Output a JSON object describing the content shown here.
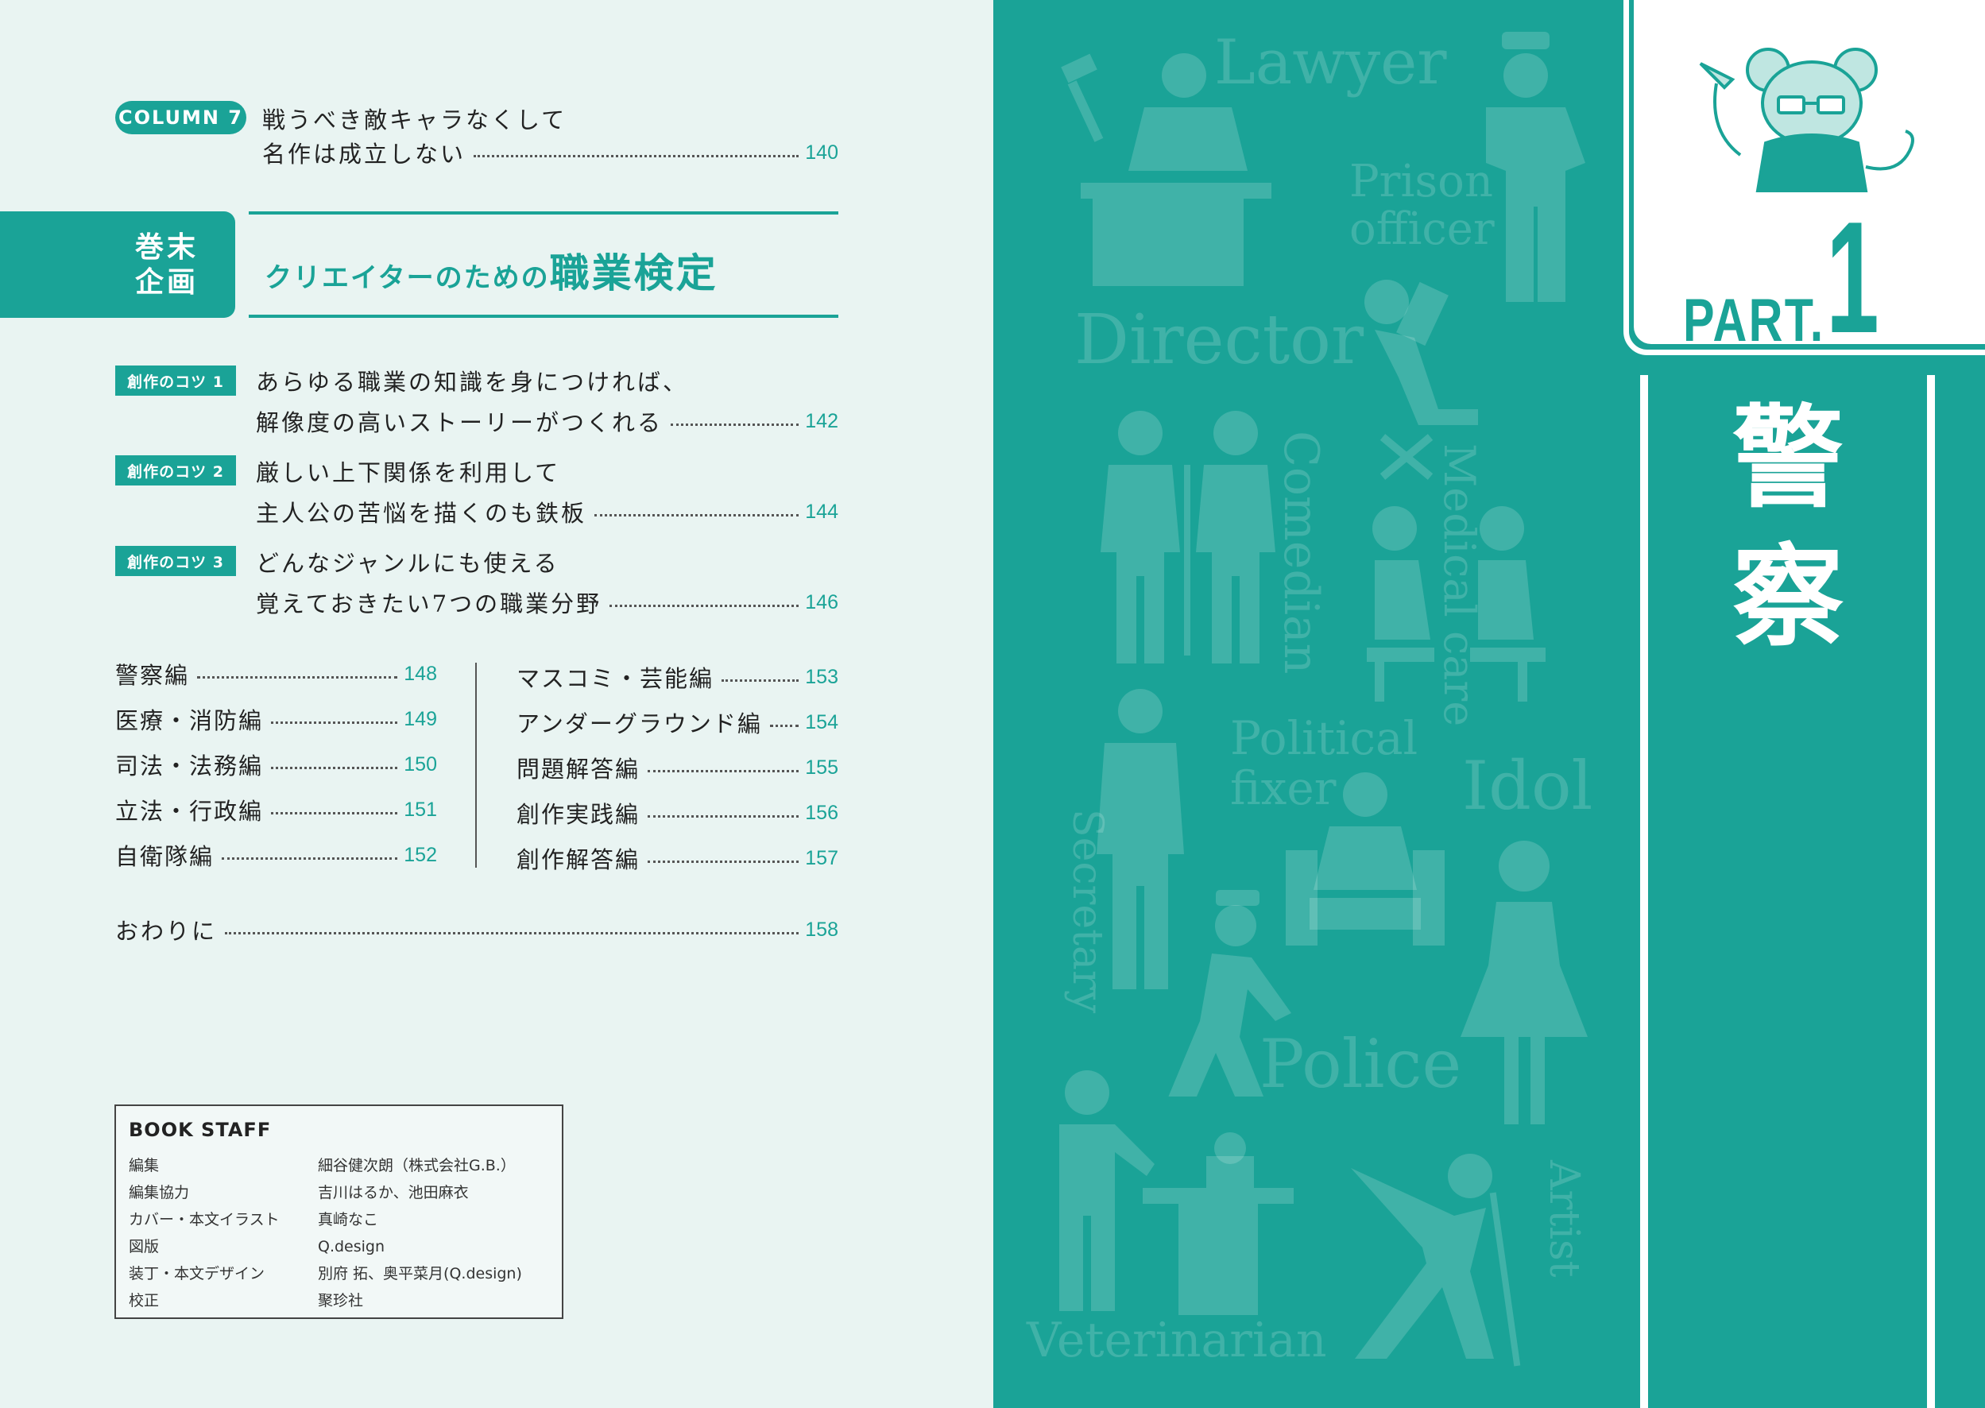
{
  "column7": {
    "badge": "COLUMN 7",
    "line1": "戦うべき敵キャラなくして",
    "line2": "名作は成立しない",
    "page": "140"
  },
  "kanmatsu": {
    "label_line1": "巻末",
    "label_line2": "企画",
    "title_small": "クリエイターのための",
    "title_big": "職業検定"
  },
  "tips": [
    {
      "badge": "創作のコツ 1",
      "line1": "あらゆる職業の知識を身につければ、",
      "line2": "解像度の高いストーリーがつくれる",
      "page": "142"
    },
    {
      "badge": "創作のコツ 2",
      "line1": "厳しい上下関係を利用して",
      "line2": "主人公の苦悩を描くのも鉄板",
      "page": "144"
    },
    {
      "badge": "創作のコツ 3",
      "line1": "どんなジャンルにも使える",
      "line2": "覚えておきたい7つの職業分野",
      "page": "146"
    }
  ],
  "chapters_left": [
    {
      "label": "警察編",
      "page": "148"
    },
    {
      "label": "医療・消防編",
      "page": "149"
    },
    {
      "label": "司法・法務編",
      "page": "150"
    },
    {
      "label": "立法・行政編",
      "page": "151"
    },
    {
      "label": "自衛隊編",
      "page": "152"
    }
  ],
  "chapters_right": [
    {
      "label": "マスコミ・芸能編",
      "page": "153"
    },
    {
      "label": "アンダーグラウンド編",
      "page": "154"
    },
    {
      "label": "問題解答編",
      "page": "155"
    },
    {
      "label": "創作実践編",
      "page": "156"
    },
    {
      "label": "創作解答編",
      "page": "157"
    }
  ],
  "afterword": {
    "label": "おわりに",
    "page": "158"
  },
  "staff": {
    "title": "BOOK STAFF",
    "rows": [
      {
        "role": "編集",
        "name": "細谷健次朗（株式会社G.B.）"
      },
      {
        "role": "編集協力",
        "name": "吉川はるか、池田麻衣"
      },
      {
        "role": "カバー・本文イラスト",
        "name": "真崎なこ"
      },
      {
        "role": "図版",
        "name": "Q.design"
      },
      {
        "role": "装丁・本文デザイン",
        "name": "別府 拓、奥平菜月(Q.design)"
      },
      {
        "role": "校正",
        "name": "聚珍社"
      }
    ]
  },
  "right_page": {
    "part_label": "PART.",
    "part_number": "1",
    "title_char1": "警",
    "title_char2": "察",
    "bg_words": {
      "lawyer": "Lawyer",
      "prison1": "Prison",
      "prison2": "officer",
      "director": "Director",
      "medical": "Medical care",
      "comedian": "Comedian",
      "political1": "Political",
      "political2": "fixer",
      "idol": "Idol",
      "secretary": "Secretary",
      "police": "Police",
      "artist": "Artist",
      "veterinarian": "Veterinarian"
    }
  },
  "colors": {
    "accent": "#1aa397",
    "page_bg": "#e9f4f2"
  }
}
